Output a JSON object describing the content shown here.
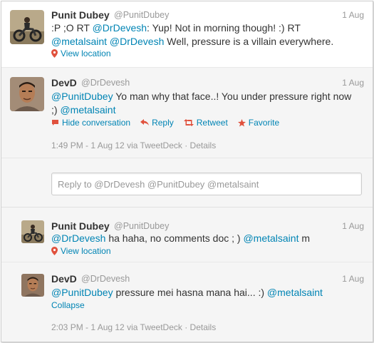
{
  "tweets": [
    {
      "name": "Punit Dubey",
      "handle": "@PunitDubey",
      "date": "1 Aug",
      "text_parts": [
        ":P ;O RT ",
        "@DrDevesh",
        ": Yup! Not in morning though! :) RT ",
        "@metalsaint",
        " ",
        "@DrDevesh",
        " Well, pressure is a villain everywhere."
      ],
      "view_location": "View location"
    },
    {
      "name": "DevD",
      "handle": "@DrDevesh",
      "date": "1 Aug",
      "text_parts": [
        "@PunitDubey",
        " Yo man why that face..! You under pressure right now ;) ",
        "@metalsaint"
      ],
      "actions": {
        "hide": "Hide conversation",
        "reply": "Reply",
        "retweet": "Retweet",
        "favorite": "Favorite"
      },
      "meta": "1:49 PM - 1 Aug 12 via TweetDeck · Details"
    },
    {
      "name": "Punit Dubey",
      "handle": "@PunitDubey",
      "date": "1 Aug",
      "text_parts": [
        "@DrDevesh",
        " ha haha, no comments doc ; ) ",
        "@metalsaint",
        " m"
      ],
      "view_location": "View location"
    },
    {
      "name": "DevD",
      "handle": "@DrDevesh",
      "date": "1 Aug",
      "text_parts": [
        "@PunitDubey",
        " pressure mei hasna mana hai... :) ",
        "@metalsaint"
      ],
      "collapse": "Collapse",
      "meta": "2:03 PM - 1 Aug 12 via TweetDeck · Details"
    }
  ],
  "reply_box": {
    "placeholder": "Reply to @DrDevesh @PunitDubey @metalsaint"
  },
  "colors": {
    "link": "#0084b4",
    "muted": "#999999",
    "text": "#333333"
  },
  "icons": {
    "location": "map-pin-icon",
    "hide": "speech-bubble-icon",
    "reply": "reply-arrow-icon",
    "retweet": "retweet-icon",
    "favorite": "star-icon"
  }
}
